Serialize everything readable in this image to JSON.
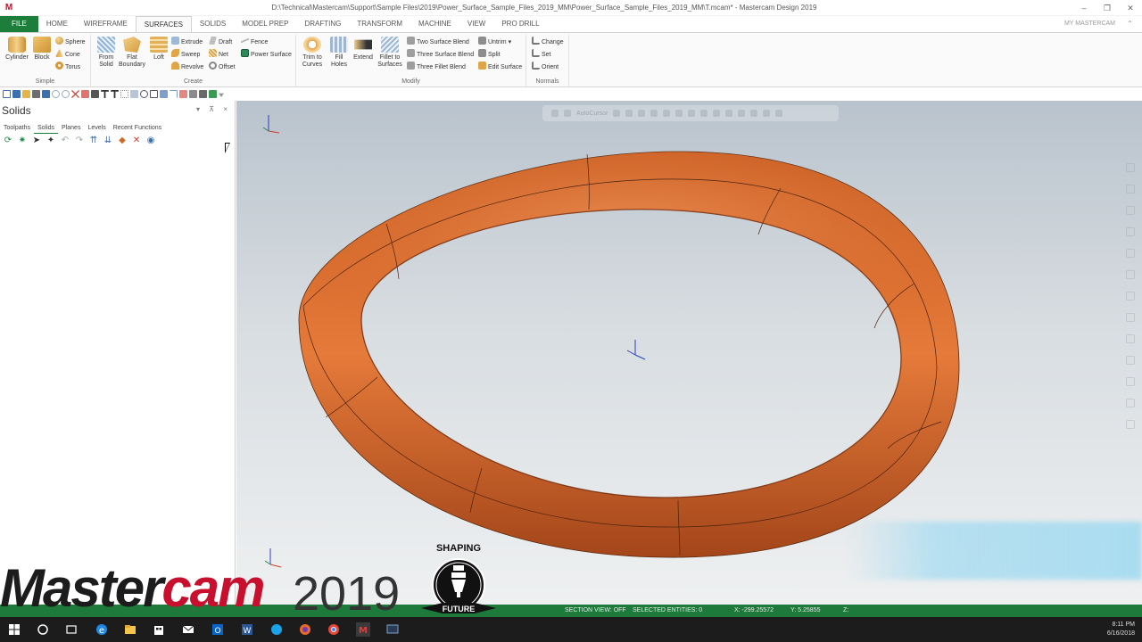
{
  "window": {
    "title": "D:\\Technical\\Mastercam\\Support\\Sample Files\\2019\\Power_Surface_Sample_Files_2019_MM\\Power_Surface_Sample_Files_2019_MM\\T.mcam* - Mastercam Design 2019",
    "app_logo": "M",
    "minimize": "–",
    "restore": "❐",
    "close": "✕"
  },
  "tabs": [
    "FILE",
    "HOME",
    "WIREFRAME",
    "SURFACES",
    "SOLIDS",
    "MODEL PREP",
    "DRAFTING",
    "TRANSFORM",
    "MACHINE",
    "VIEW",
    "PRO DRILL"
  ],
  "active_tab": "SURFACES",
  "user": "MY MASTERCAM",
  "user_caret": "⌃",
  "ribbon": {
    "simple": {
      "label": "Simple",
      "cylinder": "Cylinder",
      "block": "Block",
      "sphere": "Sphere",
      "cone": "Cone",
      "torus": "Torus"
    },
    "create": {
      "label": "Create",
      "from_solid": [
        "From",
        "Solid"
      ],
      "flat_boundary": [
        "Flat",
        "Boundary"
      ],
      "loft": "Loft",
      "extrude": "Extrude",
      "sweep": "Sweep",
      "revolve": "Revolve",
      "draft": "Draft",
      "net": "Net",
      "offset": "Offset",
      "fence": "Fence",
      "power_surface": "Power Surface"
    },
    "modify": {
      "label": "Modify",
      "trim_to_curves": [
        "Trim to",
        "Curves"
      ],
      "fill_holes": [
        "Fill",
        "Holes"
      ],
      "extend": "Extend",
      "fillet_to_surfaces": [
        "Fillet to",
        "Surfaces"
      ],
      "two_surface_blend": "Two Surface Blend",
      "three_surface_blend": "Three Surface Blend",
      "three_fillet_blend": "Three Fillet Blend",
      "untrim": "Untrim",
      "split": "Split",
      "edit_surface": "Edit Surface"
    },
    "normals": {
      "label": "Normals",
      "change": "Change",
      "set": "Set",
      "orient": "Orient"
    }
  },
  "panel": {
    "title": "Solids",
    "controls": "▾ ⊼ ×",
    "tabs": [
      "Toolpaths",
      "Solids",
      "Planes",
      "Levels",
      "Recent Functions"
    ],
    "active_tab": "Solids"
  },
  "viewport": {
    "autocursor": "AutoCursor",
    "part_color": "#d8692a"
  },
  "status": {
    "section_view": "SECTION VIEW: OFF",
    "selected": "SELECTED ENTITIES: 0",
    "x": "X:  -299.25572",
    "y": "Y:  5.25855",
    "z": "Z:"
  },
  "watermark": {
    "word_a": "Master",
    "word_b": "cam",
    "year": "2019",
    "badge_top": "SHAPING",
    "badge_bottom": "FUTURE"
  },
  "taskbar": {
    "time": "8:11 PM",
    "date": "6/16/2018"
  },
  "colors": {
    "brand_green": "#1d7d3a",
    "brand_red": "#c8102e"
  }
}
